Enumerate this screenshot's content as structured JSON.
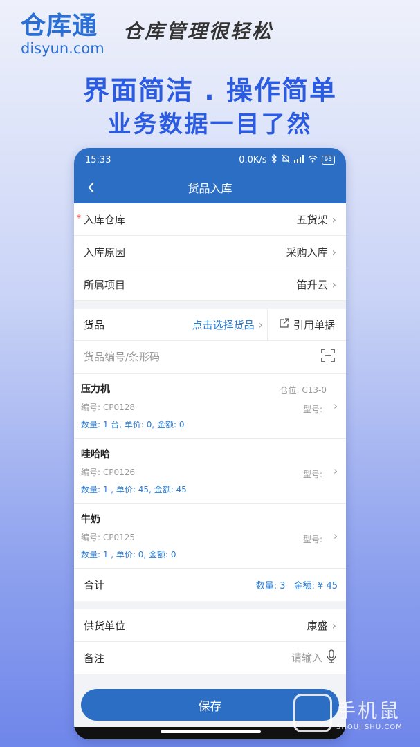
{
  "promo": {
    "brand_name": "仓库通",
    "brand_domain": "disyun.com",
    "slogan": "仓库管理很轻松",
    "headline1": "界面简洁 . 操作简单",
    "headline2": "业务数据一目了然"
  },
  "status_bar": {
    "time": "15:33",
    "speed": "0.0K/s",
    "battery": "93"
  },
  "nav": {
    "back_icon": "chevron-left-icon",
    "title": "货品入库"
  },
  "form": {
    "warehouse": {
      "required_mark": "*",
      "label": "入库仓库",
      "value": "五货架"
    },
    "reason": {
      "label": "入库原因",
      "value": "采购入库"
    },
    "project": {
      "label": "所属项目",
      "value": "笛升云"
    }
  },
  "goods": {
    "label": "货品",
    "select_label": "点击选择货品",
    "ref_label": "引用单据",
    "search_placeholder": "货品编号/条形码"
  },
  "items": [
    {
      "name": "压力机",
      "location": "仓位: C13-0",
      "code": "编号: CP0128",
      "model": "型号:",
      "qty": "数量: 1 台, 单价: 0, 金额: 0"
    },
    {
      "name": "哇哈哈",
      "location": "",
      "code": "编号: CP0126",
      "model": "型号:",
      "qty": "数量: 1 , 单价: 45, 金额: 45"
    },
    {
      "name": "牛奶",
      "location": "",
      "code": "编号: CP0125",
      "model": "型号:",
      "qty": "数量: 1 , 单价: 0, 金额: 0"
    }
  ],
  "total": {
    "label": "合计",
    "qty": "数量: 3",
    "amount": "金额: ¥ 45"
  },
  "supplier": {
    "label": "供货单位",
    "value": "康盛"
  },
  "note": {
    "label": "备注",
    "placeholder": "请输入"
  },
  "save_label": "保存",
  "watermark": {
    "cn": "手机鼠",
    "en": "SHOUJISHU.COM"
  },
  "colors": {
    "primary": "#2c6ec4",
    "accent_text": "#2a7ad0",
    "required": "#e33333"
  }
}
